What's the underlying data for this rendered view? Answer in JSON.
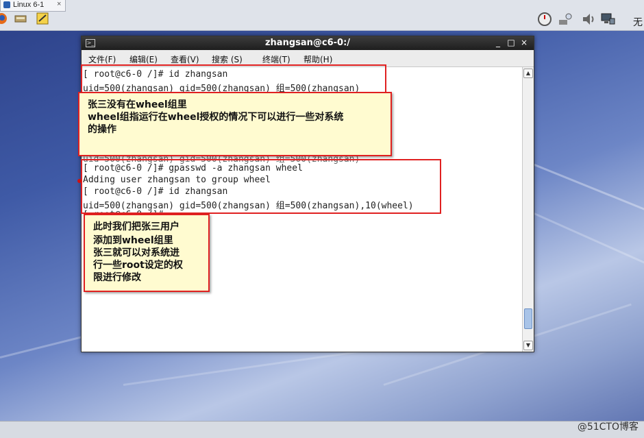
{
  "vm_tab": {
    "label": "Linux 6-1",
    "close": "×"
  },
  "corner_char": "无",
  "toolbar_icons": [
    "firefox-icon",
    "scanner-icon",
    "notepad-icon"
  ],
  "system_icons": [
    "clock-icon",
    "network-icon",
    "speaker-icon",
    "display-icon"
  ],
  "window": {
    "title": "zhangsan@c6-0:/",
    "minimize": "_",
    "maximize": "□",
    "close": "×"
  },
  "menu": [
    "文件(F)",
    "编辑(E)",
    "查看(V)",
    "搜索 (S)",
    "终端(T)",
    "帮助(H)"
  ],
  "terminal_lines": [
    "[ root@c6-0 /]# id zhangsan",
    "uid=500(zhangsan) gid=500(zhangsan) 组=500(zhangsan)",
    "uid=500(zhangsan) gid=500(zhangsan) 组=500(zhangsan)",
    "[ root@c6-0 /]# gpasswd -a zhangsan wheel",
    "Adding user zhangsan to group wheel",
    "[ root@c6-0 /]# id zhangsan",
    "uid=500(zhangsan) gid=500(zhangsan) 组=500(zhangsan),10(wheel)",
    "[ root@c6-0 /]#"
  ],
  "note1": [
    "张三没有在wheel组里",
    "wheel组指运行在wheel授权的情况下可以进行一些对系统",
    "的操作"
  ],
  "note2": [
    "此时我们把张三用户",
    "添加到wheel组里",
    "张三就可以对系统进",
    "行一些root设定的权",
    "限进行修改"
  ],
  "watermark": "@51CTO博客"
}
